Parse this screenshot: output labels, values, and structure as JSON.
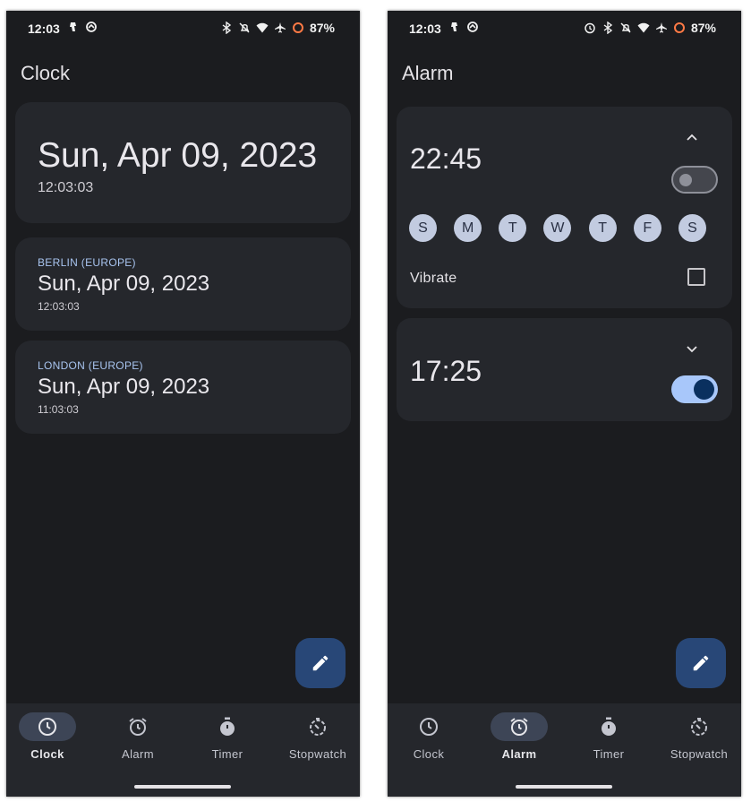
{
  "left": {
    "status": {
      "time": "12:03",
      "battery": "87%"
    },
    "title": "Clock",
    "main_clock": {
      "date": "Sun, Apr 09, 2023",
      "time": "12:03:03"
    },
    "world_clocks": [
      {
        "city": "BERLIN (EUROPE)",
        "date": "Sun, Apr 09, 2023",
        "time": "12:03:03"
      },
      {
        "city": "LONDON (EUROPE)",
        "date": "Sun, Apr 09, 2023",
        "time": "11:03:03"
      }
    ],
    "fab_icon": "edit-icon",
    "nav": [
      {
        "label": "Clock",
        "icon": "clock-icon",
        "active": true
      },
      {
        "label": "Alarm",
        "icon": "alarm-icon",
        "active": false
      },
      {
        "label": "Timer",
        "icon": "timer-icon",
        "active": false
      },
      {
        "label": "Stopwatch",
        "icon": "stopwatch-icon",
        "active": false
      }
    ]
  },
  "right": {
    "status": {
      "time": "12:03",
      "battery": "87%"
    },
    "title": "Alarm",
    "alarms": [
      {
        "time": "22:45",
        "expanded": true,
        "enabled": false,
        "days": [
          "S",
          "M",
          "T",
          "W",
          "T",
          "F",
          "S"
        ],
        "vibrate_label": "Vibrate",
        "vibrate": false
      },
      {
        "time": "17:25",
        "expanded": false,
        "enabled": true
      }
    ],
    "fab_icon": "edit-icon",
    "nav": [
      {
        "label": "Clock",
        "icon": "clock-icon",
        "active": false
      },
      {
        "label": "Alarm",
        "icon": "alarm-icon",
        "active": true
      },
      {
        "label": "Timer",
        "icon": "timer-icon",
        "active": false
      },
      {
        "label": "Stopwatch",
        "icon": "stopwatch-icon",
        "active": false
      }
    ]
  },
  "colors": {
    "background": "#1b1c1f",
    "card": "#25272c",
    "accent": "#a8c7fa",
    "fab": "#284777",
    "city_label": "#a8c4ef"
  }
}
